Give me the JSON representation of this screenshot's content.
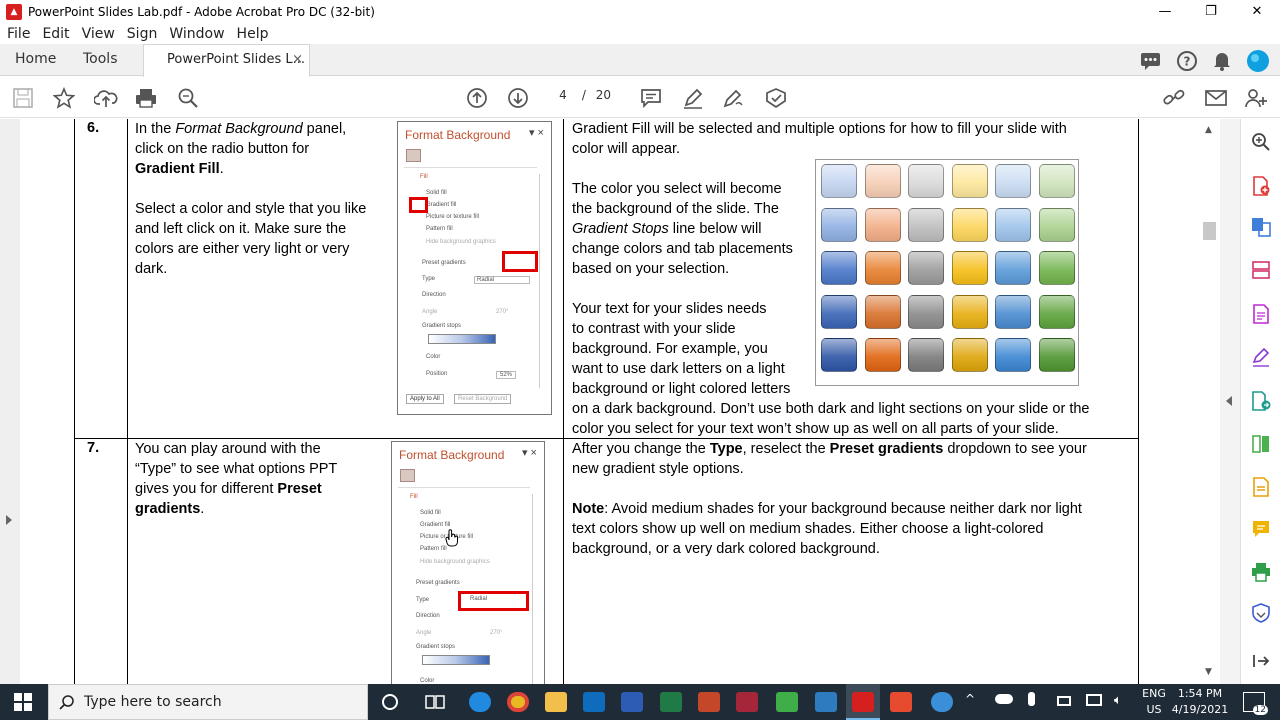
{
  "window": {
    "title": "PowerPoint Slides Lab.pdf - Adobe Acrobat Pro DC (32-bit)",
    "app_icon": "acrobat-pdf-icon",
    "controls": [
      "minimize",
      "restore",
      "close"
    ]
  },
  "menu": [
    "File",
    "Edit",
    "View",
    "Sign",
    "Window",
    "Help"
  ],
  "tabs": {
    "home": "Home",
    "tools": "Tools",
    "document": "PowerPoint Slides L...",
    "close": "×"
  },
  "pagenav": {
    "current": "4",
    "separator": "/",
    "total": "20"
  },
  "table": {
    "row6": {
      "number": "6.",
      "left_line1_pre": "In the ",
      "left_line1_em": "Format Background",
      "left_line1_post": " panel,",
      "left_line2": "click on the radio button for",
      "left_line3": "Gradient Fill",
      "left_line3_post": ".",
      "left_p2_l1": "Select a color and style that you like",
      "left_p2_l2": "and left click on it.  Make sure the",
      "left_p2_l3": "colors are either very light or very",
      "left_p2_l4": "dark.",
      "right_l1": "Gradient Fill will be selected and multiple options for how to fill your slide with",
      "right_l2": "color will appear.",
      "right_p2_l1": "The color you select will become",
      "right_p2_l2": "the background of the slide. The",
      "right_p2_l3_em": "Gradient Stops",
      "right_p2_l3_post": " line below will",
      "right_p2_l4": "change colors and tab placements",
      "right_p2_l5": "based on your selection.",
      "right_p3_l1": "Your text for your slides needs",
      "right_p3_l2": "to contrast with your slide",
      "right_p3_l3": "background.  For example, you",
      "right_p3_l4": "want to use dark letters on a light",
      "right_p3_l5": "background or light colored letters",
      "right_p3_l6": "on a dark background. Don’t use both dark and light sections on your slide or the",
      "right_p3_l7": "color you select for your text won’t show up as well on all parts of your slide."
    },
    "row7": {
      "number": "7.",
      "left_l1": "You can play around with the",
      "left_l2": "“Type” to see what options PPT",
      "left_l3_pre": "gives you for different ",
      "left_l3_b": "Preset",
      "left_l4_b": "gradients",
      "left_l4_post": ".",
      "right_l1_pre": "After you change the ",
      "right_l1_b1": "Type",
      "right_l1_mid": ", reselect the ",
      "right_l1_b2": "Preset gradients",
      "right_l1_post": " dropdown to see your",
      "right_l2": "new gradient style options.",
      "right_note_b": "Note",
      "right_note_l1": ": Avoid medium shades for your background because neither dark nor light",
      "right_note_l2": "text colors show up well on medium shades. Either choose a light-colored",
      "right_note_l3": "background, or a very dark colored background."
    }
  },
  "format_panel": {
    "title": "Format Background",
    "fill": "Fill",
    "solid": "Solid fill",
    "gradient": "Gradient fill",
    "picture": "Picture or texture fill",
    "pattern": "Pattern fill",
    "hide": "Hide background graphics",
    "preset": "Preset gradients",
    "type": "Type",
    "type_value": "Radial",
    "direction": "Direction",
    "angle": "Angle",
    "angle_value": "270°",
    "stops": "Gradient stops",
    "color": "Color",
    "position": "Position",
    "position_value": "52%",
    "apply": "Apply to All",
    "reset": "Reset Background"
  },
  "swatch_colors": {
    "row_1": [
      "#c3d4f0",
      "#f6cdb4",
      "#d9d9d9",
      "#fde79a",
      "#c9dcf2",
      "#cfe4bc"
    ],
    "row_2": [
      "#8fb0e3",
      "#f2ad85",
      "#bdbdbd",
      "#fdd55a",
      "#9dc3ea",
      "#aad18f"
    ],
    "row_3": [
      "#4a77c9",
      "#e8802f",
      "#9a9a9a",
      "#f5be16",
      "#5a9ad8",
      "#72b44d"
    ],
    "row_4": [
      "#3a64b6",
      "#d8702a",
      "#8a8a8a",
      "#e8ae10",
      "#4a8bd0",
      "#5ea33d"
    ],
    "row_5": [
      "#2d55a6",
      "#e0640f",
      "#7b7b7b",
      "#dea50a",
      "#3a85d2",
      "#4f9530"
    ]
  },
  "taskbar": {
    "search_placeholder": "Type here to search",
    "lang1": "ENG",
    "lang2": "US",
    "time": "1:54 PM",
    "date": "4/19/2021",
    "notifications": "12"
  }
}
